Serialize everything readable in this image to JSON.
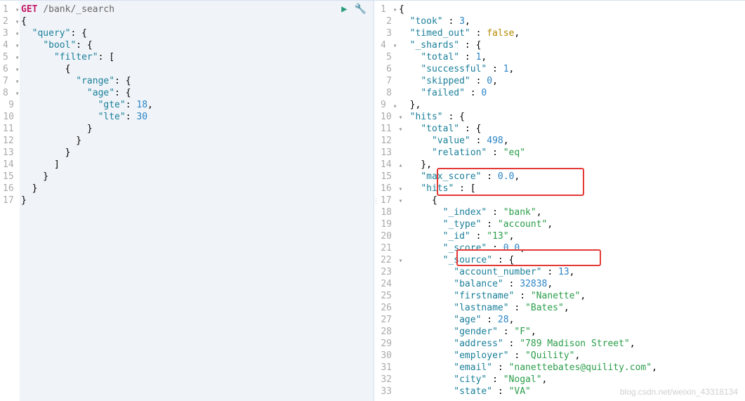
{
  "request": {
    "method": "GET",
    "path": "/bank/_search",
    "lines": [
      {
        "n": "1",
        "fold": "▾",
        "html": "<span class='method'>GET</span> <span class='path'>/bank/_search</span>"
      },
      {
        "n": "2",
        "fold": "▾",
        "html": "{"
      },
      {
        "n": "3",
        "fold": "▾",
        "html": "  <span class='key'>\"query\"</span>: {"
      },
      {
        "n": "4",
        "fold": "▾",
        "html": "    <span class='key'>\"bool\"</span>: {"
      },
      {
        "n": "5",
        "fold": "▾",
        "html": "      <span class='key'>\"filter\"</span>: ["
      },
      {
        "n": "6",
        "fold": "▾",
        "html": "        {"
      },
      {
        "n": "7",
        "fold": "▾",
        "html": "          <span class='key'>\"range\"</span>: {"
      },
      {
        "n": "8",
        "fold": "▾",
        "html": "            <span class='key'>\"age\"</span>: {"
      },
      {
        "n": "9",
        "fold": "",
        "html": "              <span class='key'>\"gte\"</span>: <span class='num'>18</span>,"
      },
      {
        "n": "10",
        "fold": "",
        "html": "              <span class='key'>\"lte\"</span>: <span class='num'>30</span>"
      },
      {
        "n": "11",
        "fold": "▴",
        "html": "            }"
      },
      {
        "n": "12",
        "fold": "▴",
        "html": "          }"
      },
      {
        "n": "13",
        "fold": "▴",
        "html": "        }"
      },
      {
        "n": "14",
        "fold": "▴",
        "html": "      ]"
      },
      {
        "n": "15",
        "fold": "▴",
        "html": "    }"
      },
      {
        "n": "16",
        "fold": "▴",
        "html": "  }"
      },
      {
        "n": "17",
        "fold": "▴",
        "html": "}"
      }
    ]
  },
  "response": {
    "lines": [
      {
        "n": "1",
        "fold": "▾",
        "html": "{"
      },
      {
        "n": "2",
        "fold": "",
        "html": "  <span class='key'>\"took\"</span> : <span class='num'>3</span>,"
      },
      {
        "n": "3",
        "fold": "",
        "html": "  <span class='key'>\"timed_out\"</span> : <span class='bool'>false</span>,"
      },
      {
        "n": "4",
        "fold": "▾",
        "html": "  <span class='key'>\"_shards\"</span> : {"
      },
      {
        "n": "5",
        "fold": "",
        "html": "    <span class='key'>\"total\"</span> : <span class='num'>1</span>,"
      },
      {
        "n": "6",
        "fold": "",
        "html": "    <span class='key'>\"successful\"</span> : <span class='num'>1</span>,"
      },
      {
        "n": "7",
        "fold": "",
        "html": "    <span class='key'>\"skipped\"</span> : <span class='num'>0</span>,"
      },
      {
        "n": "8",
        "fold": "",
        "html": "    <span class='key'>\"failed\"</span> : <span class='num'>0</span>"
      },
      {
        "n": "9",
        "fold": "▴",
        "html": "  },"
      },
      {
        "n": "10",
        "fold": "▾",
        "html": "  <span class='key'>\"hits\"</span> : {"
      },
      {
        "n": "11",
        "fold": "▾",
        "html": "    <span class='key'>\"total\"</span> : {"
      },
      {
        "n": "12",
        "fold": "",
        "html": "      <span class='key'>\"value\"</span> : <span class='num'>498</span>,"
      },
      {
        "n": "13",
        "fold": "",
        "html": "      <span class='key'>\"relation\"</span> : <span class='str'>\"eq\"</span>"
      },
      {
        "n": "14",
        "fold": "▴",
        "html": "    },"
      },
      {
        "n": "15",
        "fold": "",
        "html": "    <span class='key'>\"max_score\"</span> : <span class='num'>0.0</span>,"
      },
      {
        "n": "16",
        "fold": "▾",
        "html": "    <span class='key'>\"hits\"</span> : ["
      },
      {
        "n": "17",
        "fold": "▾",
        "html": "      {"
      },
      {
        "n": "18",
        "fold": "",
        "html": "        <span class='key'>\"_index\"</span> : <span class='str'>\"bank\"</span>,"
      },
      {
        "n": "19",
        "fold": "",
        "html": "        <span class='key'>\"_type\"</span> : <span class='str'>\"account\"</span>,"
      },
      {
        "n": "20",
        "fold": "",
        "html": "        <span class='key'>\"_id\"</span> : <span class='str'>\"13\"</span>,"
      },
      {
        "n": "21",
        "fold": "",
        "html": "        <span class='key'>\"_score\"</span> : <span class='num'>0.0</span>,"
      },
      {
        "n": "22",
        "fold": "▾",
        "html": "        <span class='key'>\"_source\"</span> : {"
      },
      {
        "n": "23",
        "fold": "",
        "html": "          <span class='key'>\"account_number\"</span> : <span class='num'>13</span>,"
      },
      {
        "n": "24",
        "fold": "",
        "html": "          <span class='key'>\"balance\"</span> : <span class='num'>32838</span>,"
      },
      {
        "n": "25",
        "fold": "",
        "html": "          <span class='key'>\"firstname\"</span> : <span class='str'>\"Nanette\"</span>,"
      },
      {
        "n": "26",
        "fold": "",
        "html": "          <span class='key'>\"lastname\"</span> : <span class='str'>\"Bates\"</span>,"
      },
      {
        "n": "27",
        "fold": "",
        "html": "          <span class='key'>\"age\"</span> : <span class='num'>28</span>,"
      },
      {
        "n": "28",
        "fold": "",
        "html": "          <span class='key'>\"gender\"</span> : <span class='str'>\"F\"</span>,"
      },
      {
        "n": "29",
        "fold": "",
        "html": "          <span class='key'>\"address\"</span> : <span class='str'>\"789 Madison Street\"</span>,"
      },
      {
        "n": "30",
        "fold": "",
        "html": "          <span class='key'>\"employer\"</span> : <span class='str'>\"Quility\"</span>,"
      },
      {
        "n": "31",
        "fold": "",
        "html": "          <span class='key'>\"email\"</span> : <span class='str'>\"nanettebates@quility.com\"</span>,"
      },
      {
        "n": "32",
        "fold": "",
        "html": "          <span class='key'>\"city\"</span> : <span class='str'>\"Nogal\"</span>,"
      },
      {
        "n": "33",
        "fold": "",
        "html": "          <span class='key'>\"state\"</span> : <span class='str'>\"VA\"</span>"
      }
    ]
  },
  "actions": {
    "run_icon": "▶",
    "wrench_icon": "🔧"
  },
  "divider_icon": "⋮",
  "watermark": "blog.csdn.net/weixin_43318134"
}
